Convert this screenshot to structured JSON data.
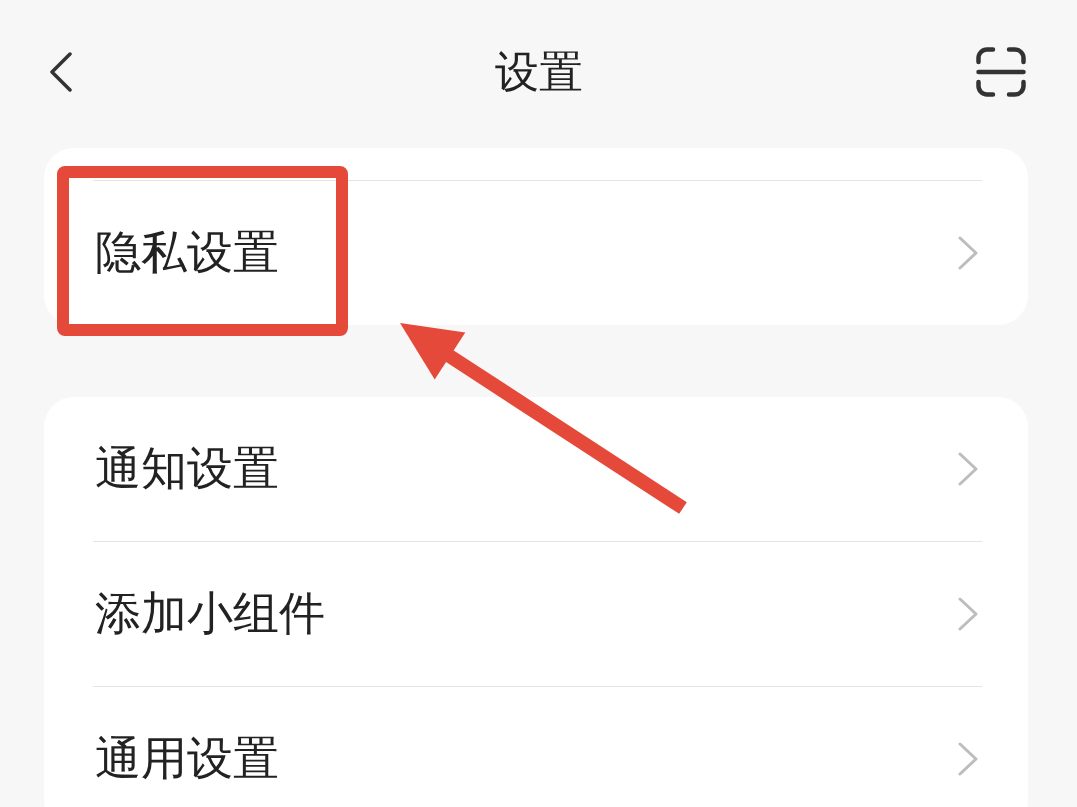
{
  "header": {
    "title": "设置"
  },
  "groups": [
    {
      "items": [
        {
          "label": "隐私设置",
          "highlighted": true
        }
      ]
    },
    {
      "items": [
        {
          "label": "通知设置",
          "highlighted": false
        },
        {
          "label": "添加小组件",
          "highlighted": false
        },
        {
          "label": "通用设置",
          "highlighted": false
        }
      ]
    }
  ]
}
